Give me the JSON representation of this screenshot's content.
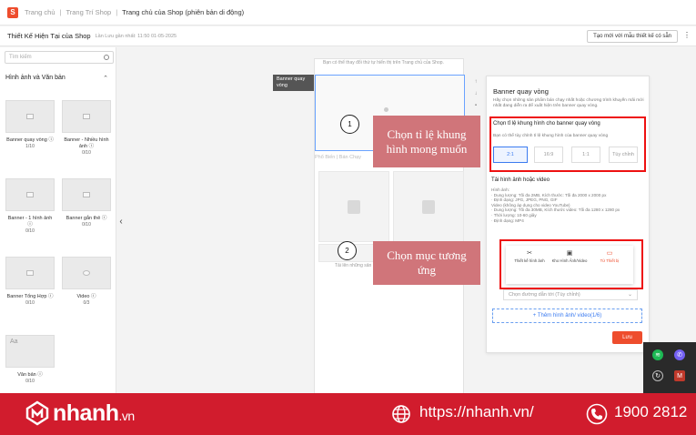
{
  "breadcrumb": {
    "items": [
      "Trang chủ",
      "Trang Trí Shop",
      "Trang chủ của Shop (phiên bản di động)"
    ],
    "separator": "|"
  },
  "header": {
    "title": "Thiết Kế Hiện Tại của Shop",
    "saved_note": "Lần Lưu gần nhất: 11:50 01-05-2025",
    "new_template_label": "Tạo mới với mẫu thiết kế có sẵn",
    "more_label": "⋮"
  },
  "sidebar": {
    "search_placeholder": "Tìm kiếm",
    "section_title": "Hình ảnh và Văn bản",
    "components": [
      {
        "label": "Banner quay vòng ⓘ",
        "count": "1/10"
      },
      {
        "label": "Banner - Nhiều hình ảnh ⓘ",
        "count": "0/10"
      },
      {
        "label": "Banner - 1 hình ảnh ⓘ",
        "count": "0/10"
      },
      {
        "label": "Banner gắn thẻ ⓘ",
        "count": "0/10"
      },
      {
        "label": "Banner Tổng Hợp ⓘ",
        "count": "0/10"
      },
      {
        "label": "Video ⓘ",
        "count": "0/3"
      },
      {
        "label": "Văn bản ⓘ",
        "count": "0/10"
      }
    ],
    "text_thumb": "Aa"
  },
  "canvas": {
    "top_note": "Bạn có thể thay đổi thứ tự hiển thị trên Trang chủ của Shop.",
    "slot_label": "Banner quay vòng",
    "tabs_text": "Phổ Biến  |  Bán Chạy",
    "footnote": "Tải lên những sản phẩm"
  },
  "panel": {
    "title": "Banner quay vòng",
    "description": "Hãy chọn những sản phẩm bán chạy nhất hoặc chương trình khuyến mãi mới nhất đang diễn ra để xuất hiện trên banner quay vòng.",
    "ratio_title": "Chọn tỉ lệ khung hình cho banner quay vòng",
    "ratio_sub": "Bạn có thể tùy chỉnh tỉ lệ khung hình của banner quay vòng",
    "ratios": [
      "2:1",
      "16:9",
      "1:1",
      "Tùy chỉnh"
    ],
    "upload_title": "Tải hình ảnh hoặc video",
    "upload_specs": [
      "Hình ảnh:",
      "· Dung lượng: Tối đa 2MB, Kích thước: Tối đa 2000 x 2000 px",
      "· Định dạng: JPG, JPEG, PNG, GIF",
      "Video (không áp dụng cho video YouTube)",
      "· Dung lượng: Tối đa 30MB, Kích thước video: Tối đa 1280 x 1280 px",
      "· Thời lượng: 10-60 giây",
      "· Định dạng: MP4"
    ],
    "media_options": [
      {
        "label": "Thiết kế hình ảnh",
        "icon": "✂"
      },
      {
        "label": "Kho Hình Ảnh/Video",
        "icon": "▣"
      },
      {
        "label": "Từ Thiết bị",
        "icon": "▭"
      }
    ],
    "link_placeholder": "Chọn đường dẫn tới   (Tùy chỉnh)",
    "add_media_label": "+ Thêm hình ảnh/ video(1/6)",
    "save_label": "Lưu"
  },
  "annotations": [
    {
      "step": "1",
      "text": "Chọn tỉ lệ khung hình mong muốn"
    },
    {
      "step": "2",
      "text": "Chọn mục tương ứng"
    }
  ],
  "brand": {
    "name": "nhanh",
    "suffix": ".vn",
    "website": "https://nhanh.vn/",
    "hotline": "1900 2812",
    "color": "#d11c2d"
  }
}
